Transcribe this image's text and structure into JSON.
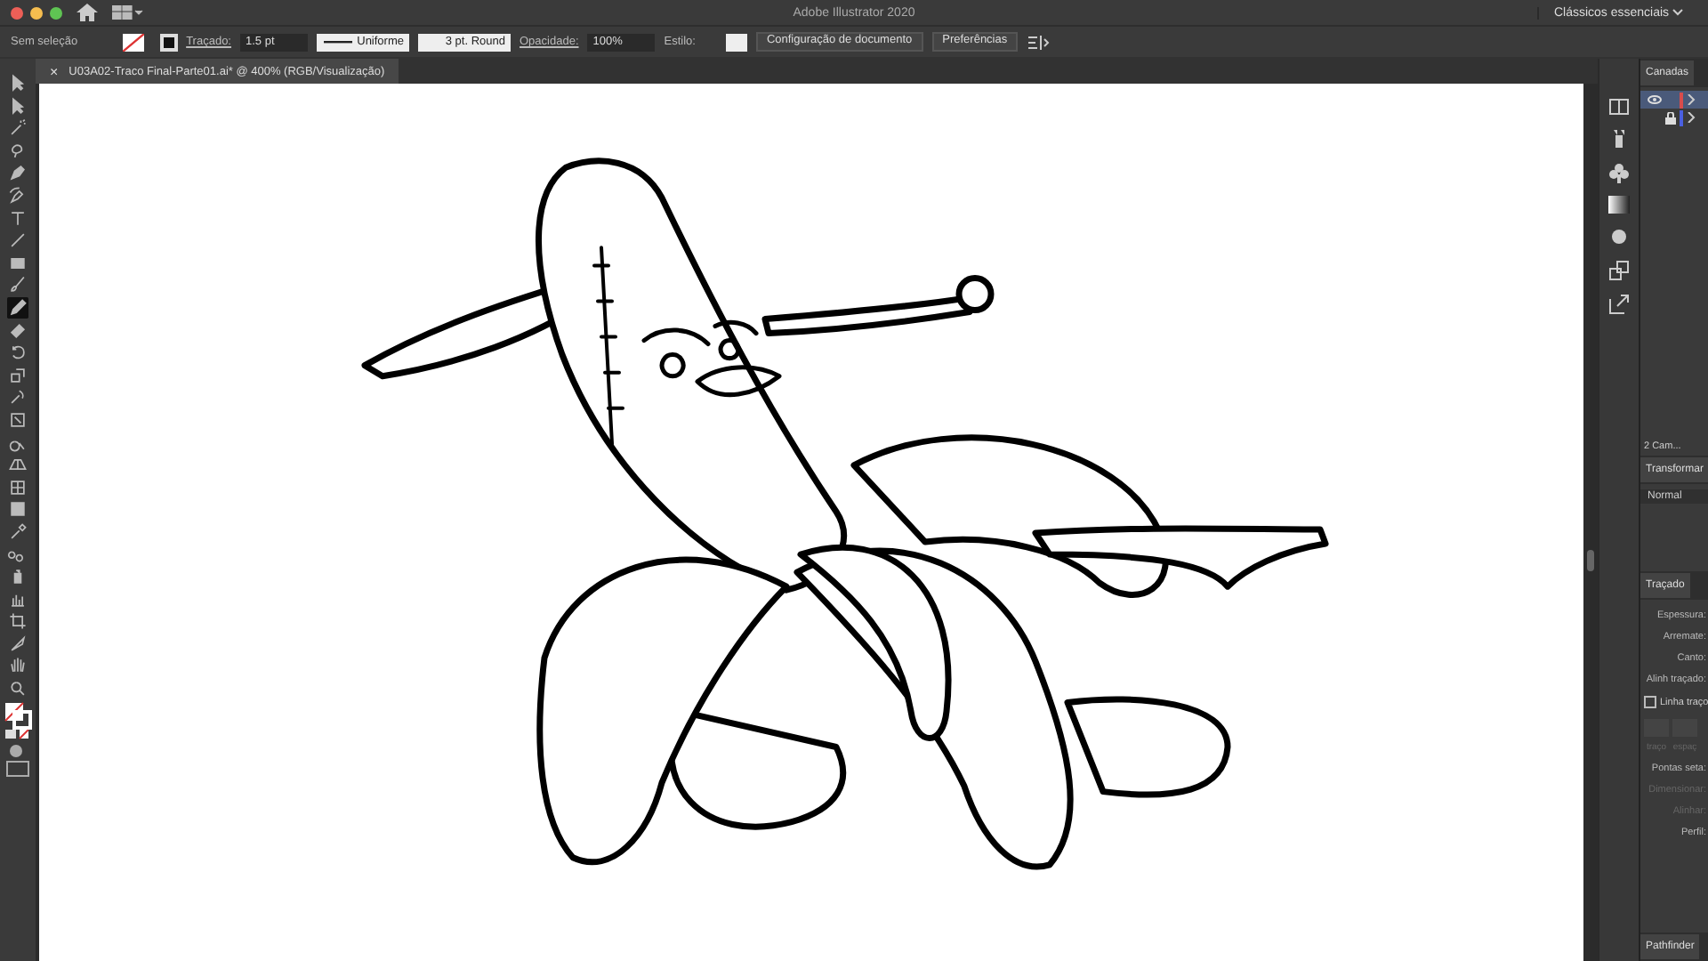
{
  "window": {
    "title": "Adobe Illustrator 2020",
    "workspace": "Clássicos essenciais"
  },
  "control_bar": {
    "selection": "Sem seleção",
    "stroke_label": "Traçado:",
    "stroke_weight": "1.5 pt",
    "profile": "Uniforme",
    "brush": "3 pt. Round",
    "opacity_label": "Opacidade:",
    "opacity": "100%",
    "style_label": "Estilo:",
    "buttons": [
      "Configuração de documento",
      "Preferências"
    ]
  },
  "document_tab": {
    "close": "×",
    "title": "U03A02-Traco Final-Parte01.ai* @ 400% (RGB/Visualização)"
  },
  "tools": [
    {
      "kind": "select",
      "selected": false
    },
    {
      "kind": "direct",
      "selected": false
    },
    {
      "kind": "wand",
      "selected": false
    },
    {
      "kind": "lasso",
      "selected": false
    },
    {
      "kind": "pen",
      "selected": false
    },
    {
      "kind": "curvature",
      "selected": false
    },
    {
      "kind": "type",
      "selected": false
    },
    {
      "kind": "line",
      "selected": false
    },
    {
      "kind": "rect",
      "selected": false
    },
    {
      "kind": "brush",
      "selected": false
    },
    {
      "kind": "pencil",
      "selected": true
    },
    {
      "kind": "eraser",
      "selected": false
    },
    {
      "kind": "rotate",
      "selected": false
    },
    {
      "kind": "scale",
      "selected": false
    },
    {
      "kind": "warp",
      "selected": false
    },
    {
      "kind": "transform",
      "selected": false
    },
    {
      "kind": "shapebuilder",
      "selected": false
    },
    {
      "kind": "perspective",
      "selected": false
    },
    {
      "kind": "mesh",
      "selected": false
    },
    {
      "kind": "gradient",
      "selected": false
    },
    {
      "kind": "eyedropper",
      "selected": false
    },
    {
      "kind": "blend",
      "selected": false
    },
    {
      "kind": "symbol",
      "selected": false
    },
    {
      "kind": "graph",
      "selected": false
    },
    {
      "kind": "artboard",
      "selected": false
    },
    {
      "kind": "slice",
      "selected": false
    },
    {
      "kind": "hand",
      "selected": false
    },
    {
      "kind": "zoom",
      "selected": false
    }
  ],
  "layers_panel": {
    "tab": "Canadas",
    "layers": [
      {
        "visible": true,
        "locked": false,
        "selected": true,
        "color": "#d84c4c"
      },
      {
        "visible": false,
        "locked": true,
        "selected": false,
        "color": "#4a5fe0"
      }
    ],
    "footer": "2 Cam..."
  },
  "transform_tab": "Transformar",
  "blend_mode": "Normal",
  "stroke_panel": {
    "title": "Traçado",
    "fields": [
      {
        "label": "Espessura:",
        "disabled": false
      },
      {
        "label": "Arremate:",
        "disabled": false
      },
      {
        "label": "Canto:",
        "disabled": false
      },
      {
        "label": "Alinh traçado:",
        "disabled": false
      }
    ],
    "dashed": {
      "label": "Linha traço",
      "checked": false
    },
    "dash_labels": [
      "traço",
      "espaç"
    ],
    "arrow_fields": [
      {
        "label": "Pontas seta:",
        "disabled": false
      },
      {
        "label": "Dimensionar:",
        "disabled": true
      },
      {
        "label": "Alinhar:",
        "disabled": true
      },
      {
        "label": "Perfil:",
        "disabled": false
      }
    ]
  },
  "pathfinder_tab": "Pathfinder"
}
